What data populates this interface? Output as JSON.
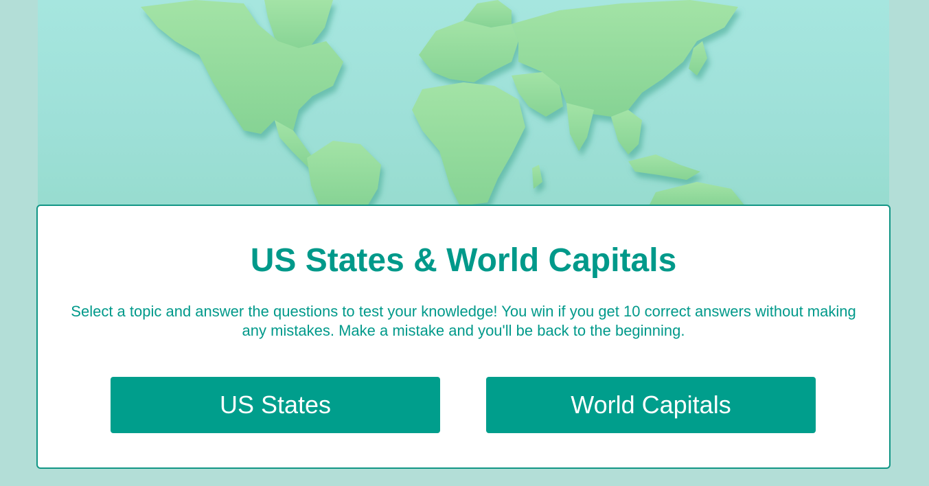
{
  "quiz": {
    "title": "US States & World Capitals",
    "description": "Select a topic and answer the questions to test your knowledge! You win if you get 10 correct answers without making any mistakes. Make a mistake and you'll be back to the beginning.",
    "topics": [
      {
        "label": "US States"
      },
      {
        "label": "World Capitals"
      }
    ]
  },
  "colors": {
    "page_background": "#b3ded7",
    "accent": "#00998a",
    "button": "#009e8c",
    "card_border": "#119585",
    "land": "#8fd99a"
  }
}
